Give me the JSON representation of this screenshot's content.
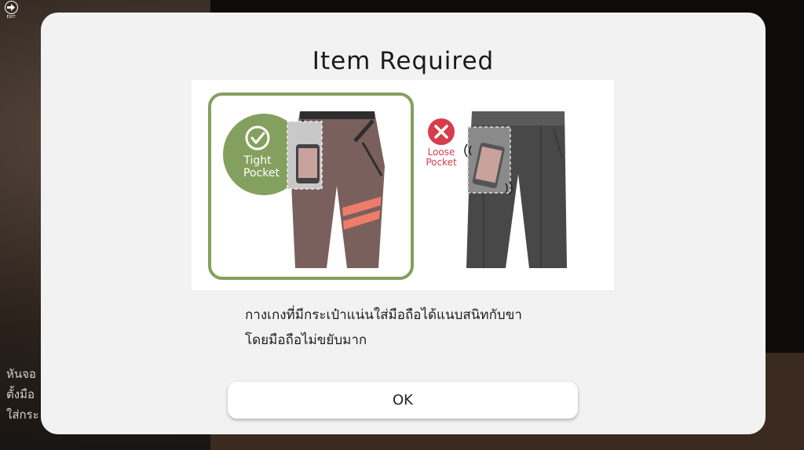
{
  "background": {
    "side_text_lines": [
      "หันจอ",
      "ตั้งมือ",
      "ใส่กระ"
    ]
  },
  "exit": {
    "label": "EXIT",
    "icon": "exit-arrow-icon"
  },
  "dialog": {
    "title": "Item Required",
    "illustration": {
      "tight_label_line1": "Tight",
      "tight_label_line2": "Pocket",
      "loose_label_line1": "Loose",
      "loose_label_line2": "Pocket"
    },
    "description_line1": "กางเกงที่มีกระเป๋าแน่นใส่มือถือได้แนบสนิทกับขา",
    "description_line2": "โดยมือถือไม่ขยับมาก",
    "ok_label": "OK"
  },
  "colors": {
    "tight_accent": "#84a05e",
    "loose_accent": "#d63c4a",
    "tight_pants": "#7a605c",
    "loose_pants": "#484848",
    "stripe": "#ef7c6a"
  }
}
